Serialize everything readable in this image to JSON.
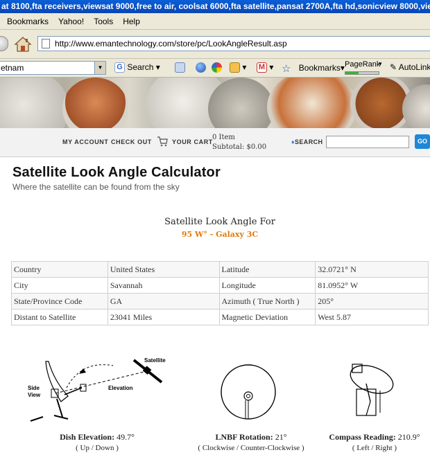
{
  "browser": {
    "window_title": "at 8100,fta receivers,viewsat 9000,free to air, coolsat 6000,fta satellite,pansat 2700A,fta hd,sonicview 8000,vie",
    "menu": [
      "Bookmarks",
      "Yahoo!",
      "Tools",
      "Help"
    ],
    "url": "http://www.emantechnology.com/store/pc/LookAngleResult.asp",
    "toolbar": {
      "search_combo_value": "etnam",
      "search_label": "Search",
      "bookmarks_label": "Bookmarks",
      "pagerank_label": "PageRank",
      "autolink_label": "AutoLink",
      "pagerank_fill": 0.4
    }
  },
  "site_nav": {
    "my_account": "MY ACCOUNT",
    "check_out": "CHECK OUT",
    "your_cart": "YOUR CART",
    "cart_items": "0 Item",
    "cart_subtotal": "Subtotal: $0.00",
    "search_label": "SEARCH",
    "search_placeholder": "",
    "go_label": "GO"
  },
  "page": {
    "title": "Satellite Look Angle Calculator",
    "subtitle": "Where the satellite can be found from the sky",
    "look_angle_for": "Satellite Look Angle For",
    "satellite": "95 W° - Galaxy 3C"
  },
  "results": [
    [
      "Country",
      "United States",
      "Latitude",
      "32.0721° N"
    ],
    [
      "City",
      "Savannah",
      "Longitude",
      "81.0952° W"
    ],
    [
      "State/Province Code",
      "GA",
      "Azimuth ( True North )",
      "205°"
    ],
    [
      "Distant to Satellite",
      "23041 Miles",
      "Magnetic Deviation",
      "West 5.87"
    ]
  ],
  "diagrams": {
    "elevation": {
      "satellite_label": "Satellite",
      "elevation_label": "Elevation",
      "side_view_label": "Side View",
      "caption_label": "Dish Elevation:",
      "caption_value": "49.7°",
      "caption_sub": "( Up / Down )"
    },
    "lnbf": {
      "caption_label": "LNBF Rotation:",
      "caption_value": "21°",
      "caption_sub": "( Clockwise / Counter-Clockwise )"
    },
    "compass": {
      "caption_label": "Compass Reading:",
      "caption_value": "210.9°",
      "caption_sub": "( Left / Right )"
    }
  }
}
